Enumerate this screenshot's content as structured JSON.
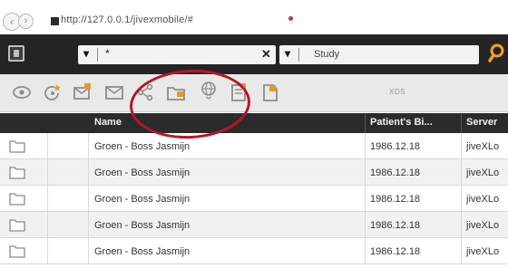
{
  "browser": {
    "url": "http://127.0.0.1/jivexmobile/#",
    "back_glyph": "‹",
    "forward_glyph": "›"
  },
  "search": {
    "patient_value": "*",
    "clear_glyph": "✕",
    "chevron_glyph": "▾",
    "study_placeholder": "Study",
    "accent_color": "#f0a020"
  },
  "toolbar": {
    "icons": [
      "eye-icon",
      "refresh-star-icon",
      "mail-send-icon",
      "mail-icon",
      "share-icon",
      "folder-export-icon",
      "web-export-icon",
      "document-icon",
      "folder-image-icon"
    ],
    "xds_label": "XDS"
  },
  "table": {
    "columns": [
      "Name",
      "Patient's Bi...",
      "Server"
    ],
    "rows": [
      {
        "name": "Groen - Boss Jasmijn",
        "birth": "1986.12.18",
        "server": "jiveXLo"
      },
      {
        "name": "Groen - Boss Jasmijn",
        "birth": "1986.12.18",
        "server": "jiveXLo"
      },
      {
        "name": "Groen - Boss Jasmijn",
        "birth": "1986.12.18",
        "server": "jiveXLo"
      },
      {
        "name": "Groen - Boss Jasmijn",
        "birth": "1986.12.18",
        "server": "jiveXLo"
      },
      {
        "name": "Groen - Boss Jasmijn",
        "birth": "1986.12.18",
        "server": "jiveXLo"
      }
    ]
  }
}
